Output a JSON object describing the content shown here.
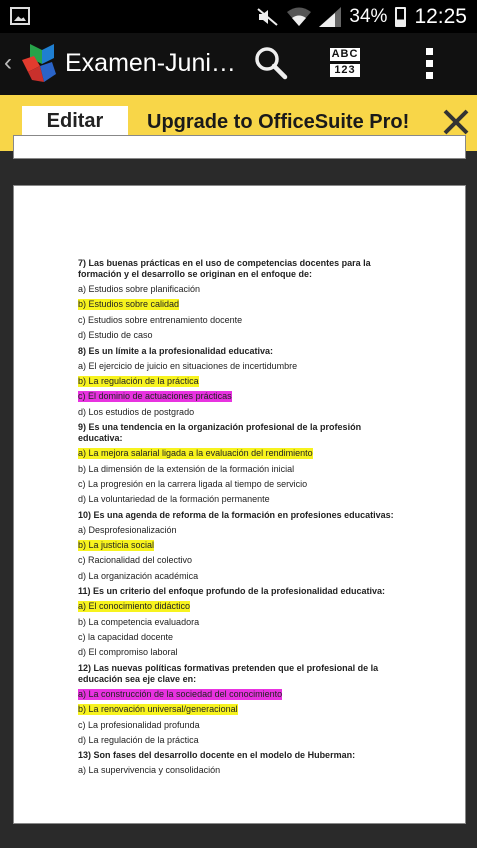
{
  "statusbar": {
    "battery": "34%",
    "time": "12:25"
  },
  "toolbar": {
    "title": "Examen-Juni…",
    "keyboard_label_top": "ABC",
    "keyboard_label_bottom": "123"
  },
  "banner": {
    "edit_label": "Editar",
    "upgrade_text": "Upgrade to OfficeSuite Pro!"
  },
  "colors": {
    "banner": "#f8d648",
    "highlight_yellow": "#f7f31e",
    "highlight_magenta": "#e832e0"
  },
  "document": {
    "questions": [
      {
        "title": "7) Las buenas prácticas en el uso de competencias docentes para la formación y el desarrollo se originan en el enfoque de:",
        "options": [
          {
            "text": "a) Estudios sobre planificación",
            "highlight": ""
          },
          {
            "text": "b) Estudios sobre calidad",
            "highlight": "yellow"
          },
          {
            "text": "c) Estudios sobre entrenamiento docente",
            "highlight": ""
          },
          {
            "text": "d) Estudio de caso",
            "highlight": ""
          }
        ]
      },
      {
        "title": "8) Es un límite a la profesionalidad educativa:",
        "options": [
          {
            "text": "a) El ejercicio de juicio en situaciones de incertidumbre",
            "highlight": ""
          },
          {
            "text": "b) La regulación de la práctica",
            "highlight": "yellow"
          },
          {
            "text": "c) El dominio de actuaciones prácticas",
            "highlight": "magenta"
          },
          {
            "text": "d) Los estudios de postgrado",
            "highlight": ""
          }
        ]
      },
      {
        "title": "9) Es una tendencia en la organización profesional de la profesión educativa:",
        "options": [
          {
            "text": "a) La mejora salarial ligada a la evaluación del rendimiento",
            "highlight": "yellow"
          },
          {
            "text": "b) La dimensión de la extensión de la formación inicial",
            "highlight": ""
          },
          {
            "text": "c) La progresión en la carrera ligada al tiempo de servicio",
            "highlight": ""
          },
          {
            "text": "d) La voluntariedad de la formación permanente",
            "highlight": ""
          }
        ]
      },
      {
        "title": "10) Es una agenda de reforma de la formación en profesiones educativas:",
        "options": [
          {
            "text": "a) Desprofesionalización",
            "highlight": ""
          },
          {
            "text": "b) La justicia social",
            "highlight": "yellow"
          },
          {
            "text": "c) Racionalidad del colectivo",
            "highlight": ""
          },
          {
            "text": "d) La organización académica",
            "highlight": ""
          }
        ]
      },
      {
        "title": "11) Es un criterio del enfoque profundo de la profesionalidad educativa:",
        "options": [
          {
            "text": "a) El conocimiento didáctico",
            "highlight": "yellow"
          },
          {
            "text": "b) La competencia evaluadora",
            "highlight": ""
          },
          {
            "text": "c) la capacidad docente",
            "highlight": ""
          },
          {
            "text": "d) El compromiso laboral",
            "highlight": ""
          }
        ]
      },
      {
        "title": "12) Las nuevas políticas formativas pretenden que el profesional de la educación sea eje clave en:",
        "options": [
          {
            "text": "a) La construcción de la sociedad del conocimiento",
            "highlight": "magenta"
          },
          {
            "text": "b) La renovación universal/generacional",
            "highlight": "yellow"
          },
          {
            "text": "c) La profesionalidad profunda",
            "highlight": ""
          },
          {
            "text": "d) La regulación de la práctica",
            "highlight": ""
          }
        ]
      },
      {
        "title": "13) Son fases del desarrollo docente en el modelo de Huberman:",
        "options": [
          {
            "text": "a) La supervivencia y consolidación",
            "highlight": ""
          }
        ]
      }
    ]
  }
}
